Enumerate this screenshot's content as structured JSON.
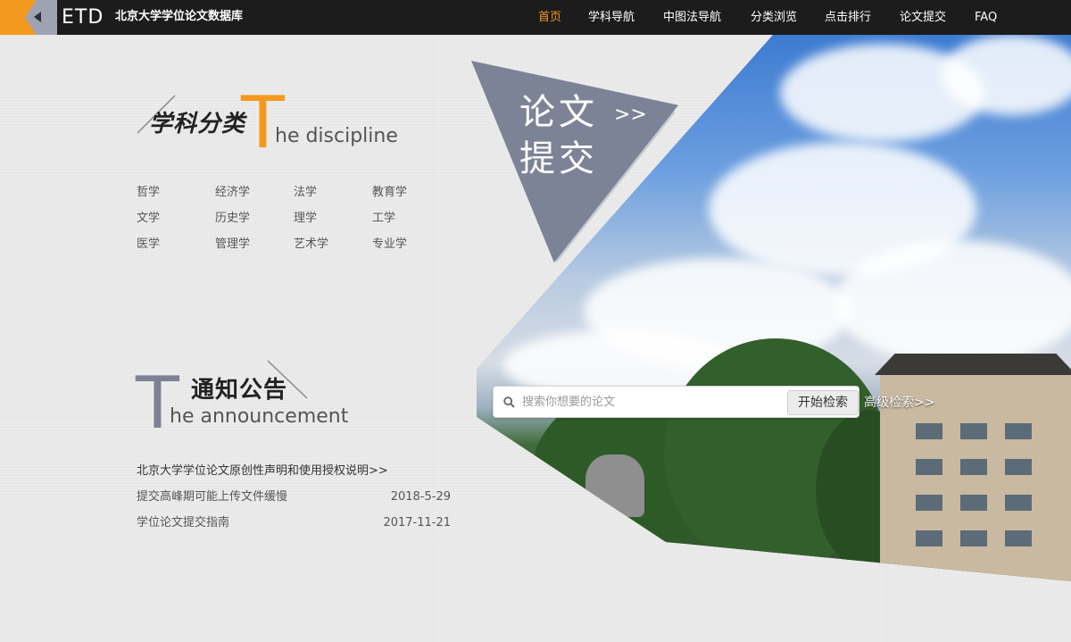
{
  "header": {
    "logo_text": "ETD",
    "site_title": "北京大学学位论文数据库",
    "nav": [
      {
        "label": "首页",
        "active": true
      },
      {
        "label": "学科导航",
        "active": false
      },
      {
        "label": "中图法导航",
        "active": false
      },
      {
        "label": "分类浏览",
        "active": false
      },
      {
        "label": "点击排行",
        "active": false
      },
      {
        "label": "论文提交",
        "active": false
      },
      {
        "label": "FAQ",
        "active": false
      }
    ]
  },
  "discipline": {
    "title_cn": "学科分类",
    "big_letter": "T",
    "title_en": "he discipline",
    "items": [
      "哲学",
      "经济学",
      "法学",
      "教育学",
      "文学",
      "历史学",
      "理学",
      "工学",
      "医学",
      "管理学",
      "艺术学",
      "专业学"
    ]
  },
  "announcement": {
    "title_cn": "通知公告",
    "big_letter": "T",
    "title_en": "he announcement",
    "items": [
      {
        "title": "北京大学学位论文原创性声明和使用授权说明>>",
        "date": ""
      },
      {
        "title": "提交高峰期可能上传文件缓慢",
        "date": "2018-5-29"
      },
      {
        "title": "学位论文提交指南",
        "date": "2017-11-21"
      }
    ]
  },
  "submit_banner": {
    "line1": "论文",
    "line2": "提交",
    "arrow": ">>"
  },
  "search": {
    "placeholder": "搜索你想要的论文",
    "button": "开始检索",
    "advanced": "高级检索>>"
  },
  "colors": {
    "accent": "#f39a1e",
    "topbar": "#1c1c1c",
    "banner": "#7d8396"
  }
}
